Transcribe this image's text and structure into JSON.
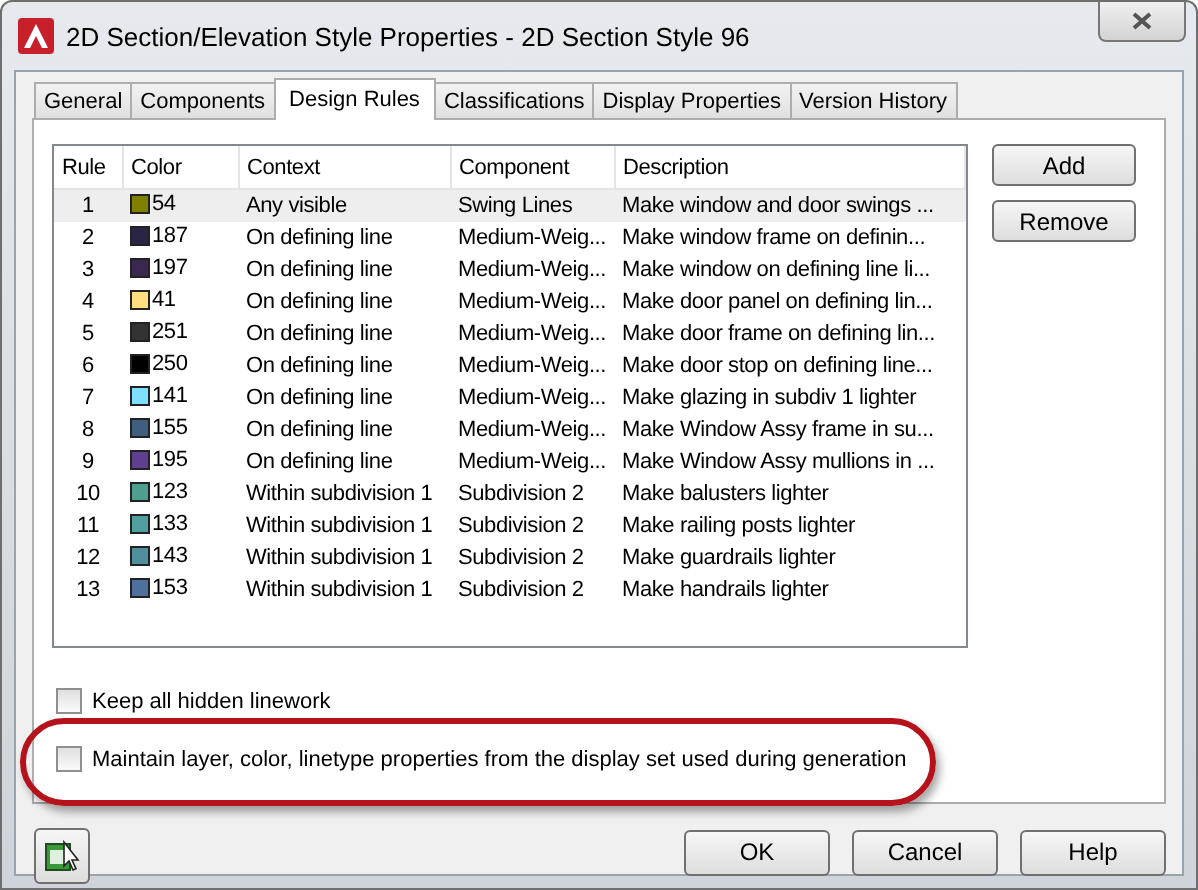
{
  "window": {
    "title": "2D Section/Elevation Style Properties - 2D Section Style 96"
  },
  "tabs": [
    {
      "label": "General",
      "selected": false
    },
    {
      "label": "Components",
      "selected": false
    },
    {
      "label": "Design Rules",
      "selected": true
    },
    {
      "label": "Classifications",
      "selected": false
    },
    {
      "label": "Display Properties",
      "selected": false
    },
    {
      "label": "Version History",
      "selected": false
    }
  ],
  "table": {
    "columns": [
      "Rule",
      "Color",
      "Context",
      "Component",
      "Description"
    ],
    "rows": [
      {
        "rule": "1",
        "color": "#808000",
        "color_number": "54",
        "context": "Any visible",
        "component": "Swing Lines",
        "description": "Make window and door swings ...",
        "selected": true
      },
      {
        "rule": "2",
        "color": "#2a2545",
        "color_number": "187",
        "context": "On defining line",
        "component": "Medium-Weig...",
        "description": "Make window frame on definin...",
        "selected": false
      },
      {
        "rule": "3",
        "color": "#3a2850",
        "color_number": "197",
        "context": "On defining line",
        "component": "Medium-Weig...",
        "description": "Make window on defining line li...",
        "selected": false
      },
      {
        "rule": "4",
        "color": "#ffdf80",
        "color_number": "41",
        "context": "On defining line",
        "component": "Medium-Weig...",
        "description": "Make door panel on defining lin...",
        "selected": false
      },
      {
        "rule": "5",
        "color": "#333333",
        "color_number": "251",
        "context": "On defining line",
        "component": "Medium-Weig...",
        "description": "Make door frame on defining lin...",
        "selected": false
      },
      {
        "rule": "6",
        "color": "#000000",
        "color_number": "250",
        "context": "On defining line",
        "component": "Medium-Weig...",
        "description": "Make door stop on defining line...",
        "selected": false
      },
      {
        "rule": "7",
        "color": "#7fdfff",
        "color_number": "141",
        "context": "On defining line",
        "component": "Medium-Weig...",
        "description": "Make glazing in subdiv 1 lighter",
        "selected": false
      },
      {
        "rule": "8",
        "color": "#3f5f7f",
        "color_number": "155",
        "context": "On defining line",
        "component": "Medium-Weig...",
        "description": "Make Window Assy frame in su...",
        "selected": false
      },
      {
        "rule": "9",
        "color": "#5f3f8f",
        "color_number": "195",
        "context": "On defining line",
        "component": "Medium-Weig...",
        "description": "Make Window Assy mullions in ...",
        "selected": false
      },
      {
        "rule": "10",
        "color": "#4f9f8f",
        "color_number": "123",
        "context": "Within subdivision 1",
        "component": "Subdivision 2",
        "description": "Make balusters lighter",
        "selected": false
      },
      {
        "rule": "11",
        "color": "#4f9f9f",
        "color_number": "133",
        "context": "Within subdivision 1",
        "component": "Subdivision 2",
        "description": "Make railing posts lighter",
        "selected": false
      },
      {
        "rule": "12",
        "color": "#4f8f9f",
        "color_number": "143",
        "context": "Within subdivision 1",
        "component": "Subdivision 2",
        "description": "Make guardrails lighter",
        "selected": false
      },
      {
        "rule": "13",
        "color": "#4f6f9f",
        "color_number": "153",
        "context": "Within subdivision 1",
        "component": "Subdivision 2",
        "description": "Make handrails lighter",
        "selected": false
      }
    ]
  },
  "side_buttons": [
    "Add",
    "Remove"
  ],
  "options": [
    {
      "label": "Keep all hidden linework",
      "checked": false,
      "highlighted": false
    },
    {
      "label": "Maintain layer, color, linetype properties from the display set used during generation",
      "checked": false,
      "highlighted": true
    }
  ],
  "buttons": [
    "OK",
    "Cancel",
    "Help"
  ]
}
